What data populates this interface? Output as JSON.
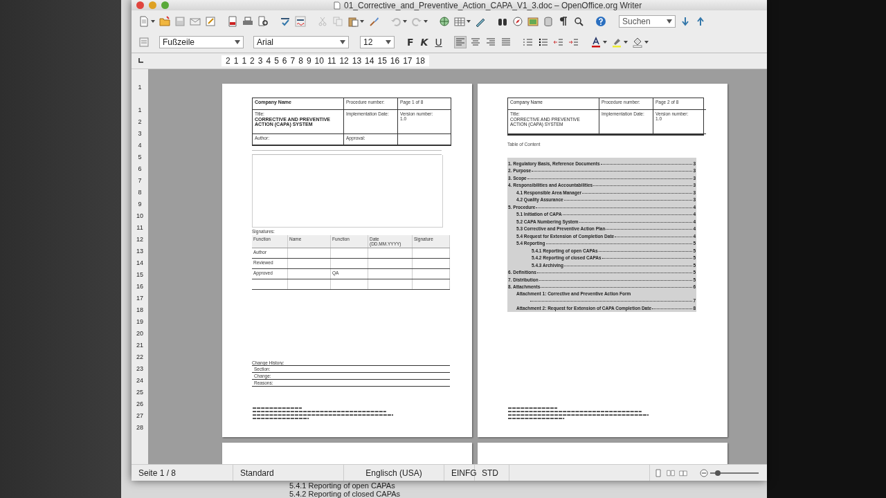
{
  "window": {
    "title": "01_Corrective_and_Preventive_Action_CAPA_V1_3.doc – OpenOffice.org Writer"
  },
  "search": {
    "value": "Suchen"
  },
  "formatting": {
    "paragraph_style": "Fußzeile",
    "font": "Arial",
    "size": "12",
    "bold": "F",
    "italic": "K",
    "underline": "U"
  },
  "ruler": [
    "2",
    "1",
    "1",
    "2",
    "3",
    "4",
    "5",
    "6",
    "7",
    "8",
    "9",
    "10",
    "11",
    "12",
    "13",
    "14",
    "15",
    "16",
    "17",
    "18"
  ],
  "vertical_ruler": [
    "1",
    "1",
    "2",
    "3",
    "4",
    "5",
    "6",
    "7",
    "8",
    "9",
    "10",
    "11",
    "12",
    "13",
    "14",
    "15",
    "16",
    "17",
    "18",
    "19",
    "20",
    "21",
    "22",
    "23",
    "24",
    "25",
    "26",
    "27",
    "28"
  ],
  "pages": [
    {
      "header": {
        "company": "Company Name",
        "procedure": "Procedure number:",
        "page": "Page 1 of 8",
        "title_label": "Title:",
        "title": "CORRECTIVE AND PREVENTIVE ACTION (CAPA) SYSTEM",
        "implementation": "Implementation Date:",
        "version_label": "Version number:",
        "version": "1.0",
        "author": "Author:",
        "approval": "Approval:"
      },
      "signatures": {
        "label": "Signatures:",
        "columns": [
          "Function",
          "Name",
          "Function",
          "Date (DD.MM.YYYY)",
          "Signature"
        ],
        "rows": [
          {
            "role": "Author"
          },
          {
            "role": "Reviewed"
          },
          {
            "role": "Approved",
            "function": "QA"
          },
          {}
        ]
      },
      "change_history": {
        "label": "Change History:",
        "items": [
          "Section:",
          "Change:",
          "Reasons:"
        ]
      }
    },
    {
      "header": {
        "company": "Company Name",
        "procedure": "Procedure number:",
        "page": "Page 2 of 8",
        "title_label": "Title:",
        "title": "CORRECTIVE AND PREVENTIVE ACTION (CAPA) SYSTEM",
        "implementation": "Implementation Date:",
        "version_label": "Version number:",
        "version": "1.0"
      },
      "toc": {
        "title": "Table of Content",
        "entries": [
          {
            "text": "1. Regulatory Basis, Reference Documents",
            "page": "3"
          },
          {
            "text": "2. Purpose",
            "page": "3"
          },
          {
            "text": "3. Scope",
            "page": "3"
          },
          {
            "text": "4. Responsibilities and Accountabilities",
            "page": "3",
            "children": [
              {
                "text": "4.1 Responsible Area Manager",
                "page": "3"
              },
              {
                "text": "4.2 Quality Assurance",
                "page": "3"
              }
            ]
          },
          {
            "text": "5. Procedure",
            "page": "4",
            "children": [
              {
                "text": "5.1 Initiation of CAPA",
                "page": "4"
              },
              {
                "text": "5.2 CAPA Numbering System",
                "page": "4"
              },
              {
                "text": "5.3 Corrective and Preventive Action Plan",
                "page": "4"
              },
              {
                "text": "5.4 Request for Extension of Completion Date",
                "page": "4"
              },
              {
                "text": "5.4 Reporting",
                "page": "5",
                "children": [
                  {
                    "text": "5.4.1 Reporting of open CAPAs",
                    "page": "5"
                  },
                  {
                    "text": "5.4.2 Reporting of closed CAPAs",
                    "page": "5"
                  },
                  {
                    "text": "5.4.3 Archiving",
                    "page": "5"
                  }
                ]
              }
            ]
          },
          {
            "text": "6. Definitions",
            "page": "5"
          },
          {
            "text": "7. Distribution",
            "page": "5"
          },
          {
            "text": "8. Attachments",
            "page": "6",
            "children": [
              {
                "text": "Attachment 1: Corrective and Preventive Action Form",
                "page": "7",
                "wrapped": true
              },
              {
                "text": "Attachment 2: Request for Extension of CAPA Completion Date",
                "page": "8"
              }
            ]
          }
        ]
      }
    }
  ],
  "status_bar": {
    "page": "Seite 1 / 8",
    "style": "Standard",
    "language": "Englisch (USA)",
    "insert_mode": "EINFG",
    "selection_mode": "STD",
    "zoom": {
      "level": 0.15
    }
  },
  "background_text": [
    "5.4.1 Reporting of open CAPAs",
    "5.4.2 Reporting of closed CAPAs"
  ]
}
